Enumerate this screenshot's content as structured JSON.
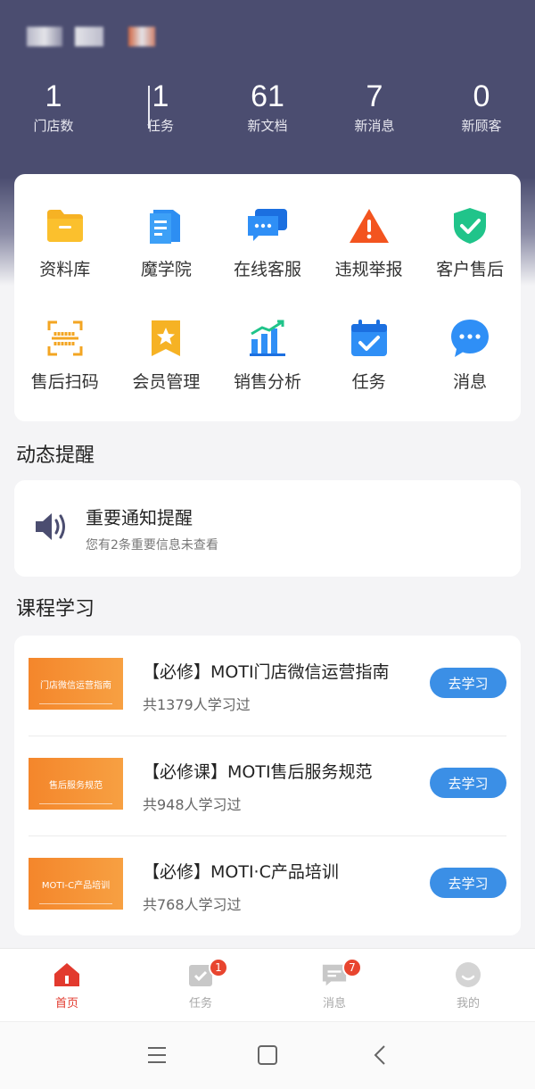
{
  "colors": {
    "header_bg": "#4b4d70",
    "accent_blue": "#3b8fe6",
    "active_red": "#e23a2e",
    "badge_red": "#e8452f",
    "course_thumb_orange": "#f4862b"
  },
  "stats": [
    {
      "value": "1",
      "label": "门店数"
    },
    {
      "value": "1",
      "label": "任务"
    },
    {
      "value": "61",
      "label": "新文档"
    },
    {
      "value": "7",
      "label": "新消息"
    },
    {
      "value": "0",
      "label": "新顾客"
    }
  ],
  "shortcuts": [
    {
      "label": "资料库",
      "icon": "folder-icon"
    },
    {
      "label": "魔学院",
      "icon": "book-icon"
    },
    {
      "label": "在线客服",
      "icon": "chat-bubbles-icon"
    },
    {
      "label": "违规举报",
      "icon": "warning-icon"
    },
    {
      "label": "客户售后",
      "icon": "shield-check-icon"
    },
    {
      "label": "售后扫码",
      "icon": "scan-icon"
    },
    {
      "label": "会员管理",
      "icon": "member-star-icon"
    },
    {
      "label": "销售分析",
      "icon": "bar-chart-icon"
    },
    {
      "label": "任务",
      "icon": "calendar-check-icon"
    },
    {
      "label": "消息",
      "icon": "message-bubble-icon"
    }
  ],
  "notices": {
    "section_title": "动态提醒",
    "title": "重要通知提醒",
    "subtitle": "您有2条重要信息未查看"
  },
  "courses": {
    "section_title": "课程学习",
    "button_label": "去学习",
    "items": [
      {
        "thumb_text": "门店微信运营指南",
        "title": "【必修】MOTI门店微信运营指南",
        "learners": "共1379人学习过"
      },
      {
        "thumb_text": "售后服务规范",
        "title": "【必修课】MOTI售后服务规范",
        "learners": "共948人学习过"
      },
      {
        "thumb_text": "MOTI-C产品培训",
        "title": "【必修】MOTI·C产品培训",
        "learners": "共768人学习过"
      }
    ]
  },
  "tabbar": [
    {
      "label": "首页",
      "icon": "home-icon",
      "active": true,
      "badge": ""
    },
    {
      "label": "任务",
      "icon": "task-icon",
      "active": false,
      "badge": "1"
    },
    {
      "label": "消息",
      "icon": "message-icon",
      "active": false,
      "badge": "7"
    },
    {
      "label": "我的",
      "icon": "profile-icon",
      "active": false,
      "badge": ""
    }
  ]
}
